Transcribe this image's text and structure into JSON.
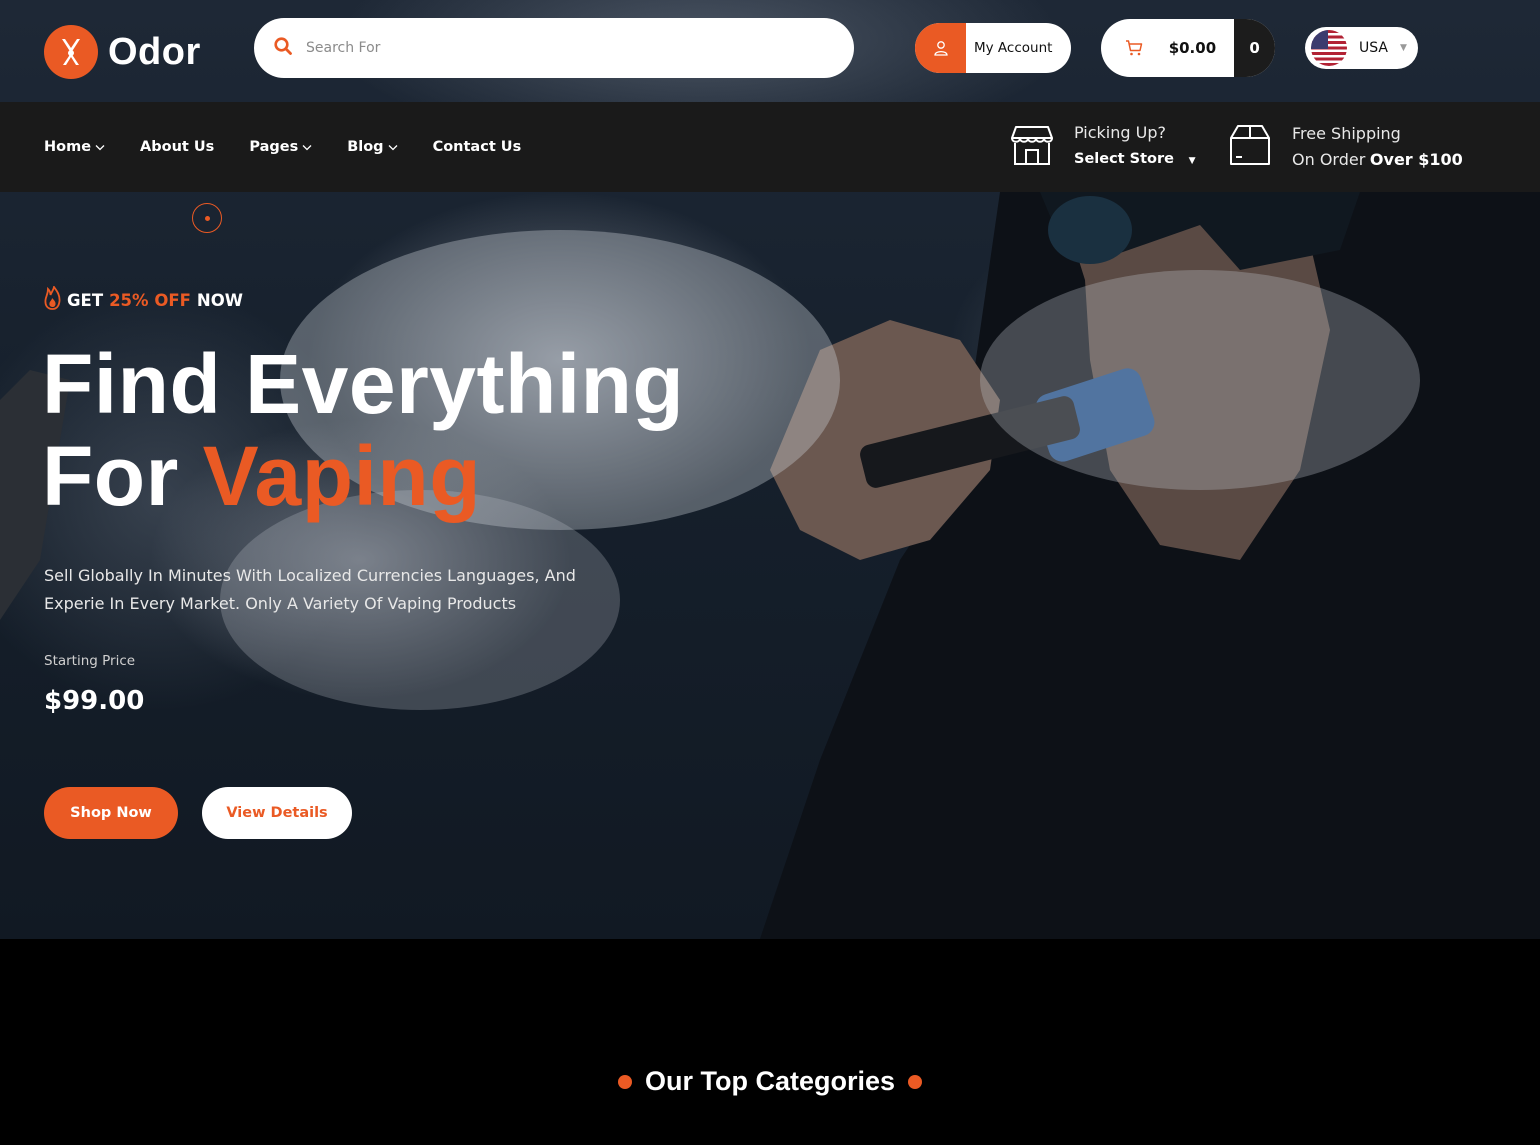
{
  "brand": {
    "name": "Odor",
    "accent_color": "#ea5a24"
  },
  "header": {
    "search_placeholder": "Search For",
    "account_label": "My Account",
    "cart_total": "$0.00",
    "cart_count": "0",
    "currency": "USA"
  },
  "nav": {
    "items": [
      {
        "label": "Home",
        "has_dropdown": true
      },
      {
        "label": "About Us",
        "has_dropdown": false
      },
      {
        "label": "Pages",
        "has_dropdown": true
      },
      {
        "label": "Blog",
        "has_dropdown": true
      },
      {
        "label": "Contact Us",
        "has_dropdown": false
      }
    ],
    "pickup": {
      "title": "Picking Up?",
      "action": "Select Store"
    },
    "shipping": {
      "title": "Free Shipping",
      "line2_prefix": "On Order",
      "line2_bold": "Over $100"
    }
  },
  "hero": {
    "promo_prefix": "GET",
    "promo_highlight": "25% OFF",
    "promo_suffix": "NOW",
    "headline_line1": "Find Everything",
    "headline_line2_prefix": "For",
    "headline_line2_accent": "Vaping",
    "description": "Sell Globally In Minutes With Localized Currencies Languages, And Experie In Every Market. Only A Variety Of Vaping Products",
    "price_label": "Starting Price",
    "price": "$99.00",
    "primary_button": "Shop Now",
    "secondary_button": "View Details"
  },
  "categories": {
    "title": "Our Top Categories"
  }
}
